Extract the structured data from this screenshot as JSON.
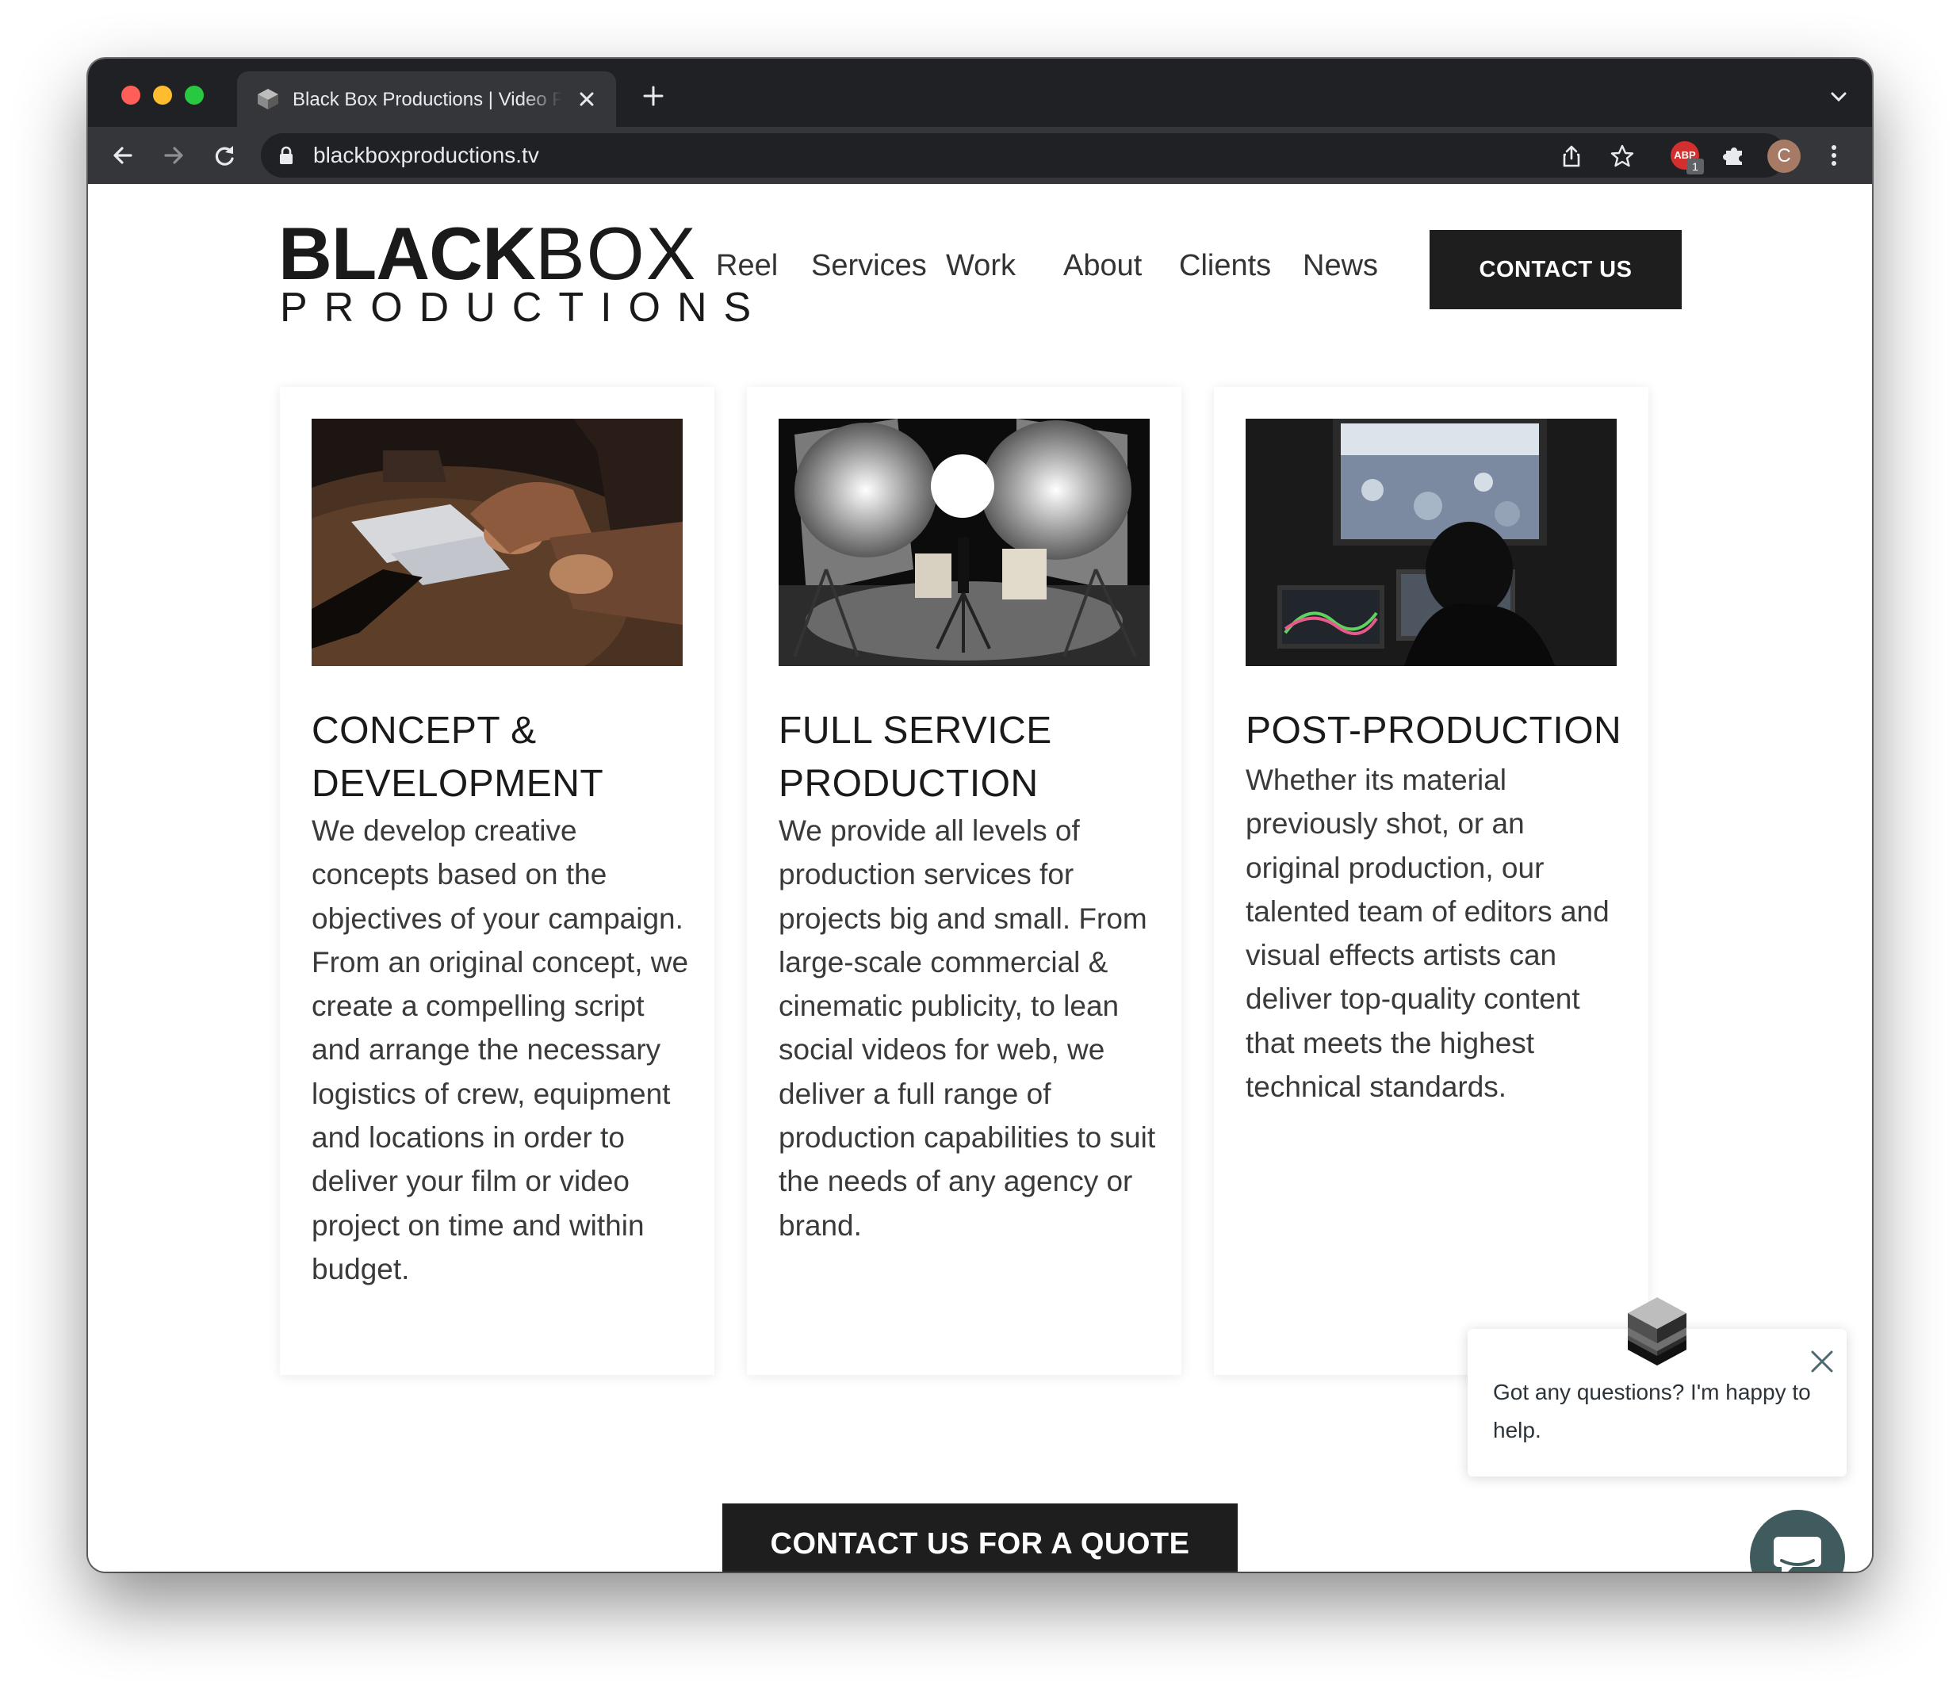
{
  "browser": {
    "tab_title": "Black Box Productions | Video Production",
    "url": "blackboxproductions.tv",
    "extension_badge": "ABP",
    "extension_count": "1",
    "profile_initial": "C"
  },
  "header": {
    "logo_bold": "BLACK",
    "logo_light": "BOX",
    "logo_sub": "PRODUCTIONS",
    "nav": [
      "Reel",
      "Services",
      "Work",
      "About",
      "Clients",
      "News"
    ],
    "contact_label": "CONTACT US"
  },
  "cards": [
    {
      "title": "CONCEPT & DEVELOPMENT",
      "text": "We develop creative concepts based on the objectives of your campaign. From an original concept, we create a compelling script and arrange the necessary logistics of crew, equipment and locations in order to deliver your film or video project on time and within budget."
    },
    {
      "title": "FULL SERVICE PRODUCTION",
      "text": "We provide all levels of production services for projects big and small. From large-scale commercial & cinematic publicity, to lean social videos for web, we deliver a full range of production capabilities to suit the needs of any agency or brand."
    },
    {
      "title": "POST-PRODUCTION",
      "text": "Whether its material previously shot, or an original production, our talented team of editors and visual effects artists can deliver top-quality content that meets the highest technical standards."
    }
  ],
  "quote_button": "CONTACT US FOR A QUOTE",
  "chat": {
    "message": "Got any questions? I'm happy to help."
  },
  "colors": {
    "button_bg": "#1e1e1e",
    "chat_launcher": "#3f5b5e",
    "browser_chrome": "#202124"
  }
}
